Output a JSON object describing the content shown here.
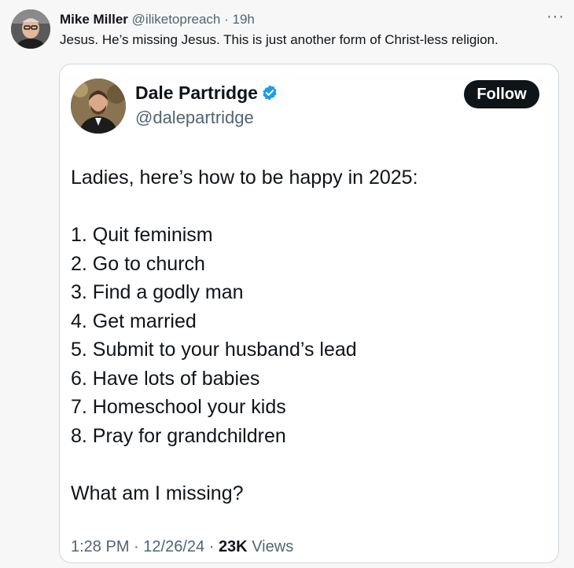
{
  "post": {
    "author_name": "Mike Miller",
    "author_handle": "@iliketopreach",
    "separator": "·",
    "time": "19h",
    "more_label": "···",
    "text": "Jesus. He’s missing Jesus. This is just another form of Christ-less religion."
  },
  "quoted": {
    "author_name": "Dale Partridge",
    "author_handle": "@dalepartridge",
    "follow_label": "Follow",
    "intro": "Ladies, here’s how to be happy in 2025:",
    "items": [
      "1. Quit feminism",
      "2. Go to church",
      "3. Find a godly man",
      "4. Get married",
      "5. Submit to your husband’s lead",
      "6. Have lots of babies",
      "7. Homeschool your kids",
      "8. Pray for grandchildren"
    ],
    "closing": "What am I missing?",
    "time": "1:28 PM",
    "date": "12/26/24",
    "separator": "·",
    "views_count": "23K",
    "views_label": "Views"
  },
  "colors": {
    "background": "#f7f7f7",
    "card": "#ffffff",
    "text": "#0f1419",
    "secondary": "#536471",
    "verified": "#1d9bf0",
    "follow_bg": "#0f1419"
  },
  "icons": {
    "verified": "verified-badge-icon",
    "more": "more-dots-icon"
  }
}
